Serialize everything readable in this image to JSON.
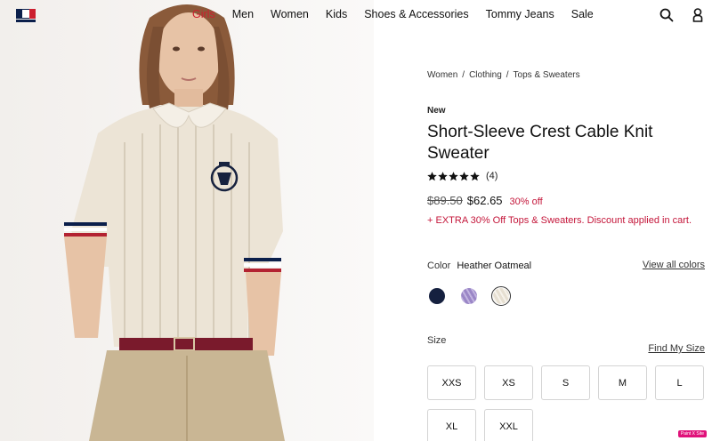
{
  "header": {
    "logo": "tommy-hilfiger-flag-logo",
    "nav": [
      "Girls",
      "Men",
      "Women",
      "Kids",
      "Shoes & Accessories",
      "Tommy Jeans",
      "Sale"
    ],
    "active_nav": "Girls",
    "icons": [
      "search-icon",
      "account-icon"
    ]
  },
  "breadcrumb": [
    "Women",
    "Clothing",
    "Tops & Sweaters"
  ],
  "product": {
    "tag": "New",
    "title": "Short-Sleeve Crest Cable Knit Sweater",
    "rating": 5,
    "rating_count": "(4)",
    "original_price": "$89.50",
    "sale_price": "$62.65",
    "discount": "30% off",
    "promo": "+ EXTRA 30% Off Tops & Sweaters. Discount applied in cart."
  },
  "color": {
    "label": "Color",
    "selected": "Heather Oatmeal",
    "view_all": "View all colors",
    "swatches": [
      {
        "name": "navy",
        "color": "#15203f"
      },
      {
        "name": "lavender",
        "color": "#a08cc9"
      },
      {
        "name": "heather-oatmeal",
        "color": "#ece6da"
      }
    ]
  },
  "size": {
    "label": "Size",
    "find_size": "Find My Size",
    "options": [
      "XXS",
      "XS",
      "S",
      "M",
      "L",
      "XL",
      "XXL"
    ]
  },
  "badge": "Paint X Site",
  "colors": {
    "accent_red": "#cc1f2f",
    "promo_red": "#c4163a",
    "navy": "#0b1f4b"
  }
}
